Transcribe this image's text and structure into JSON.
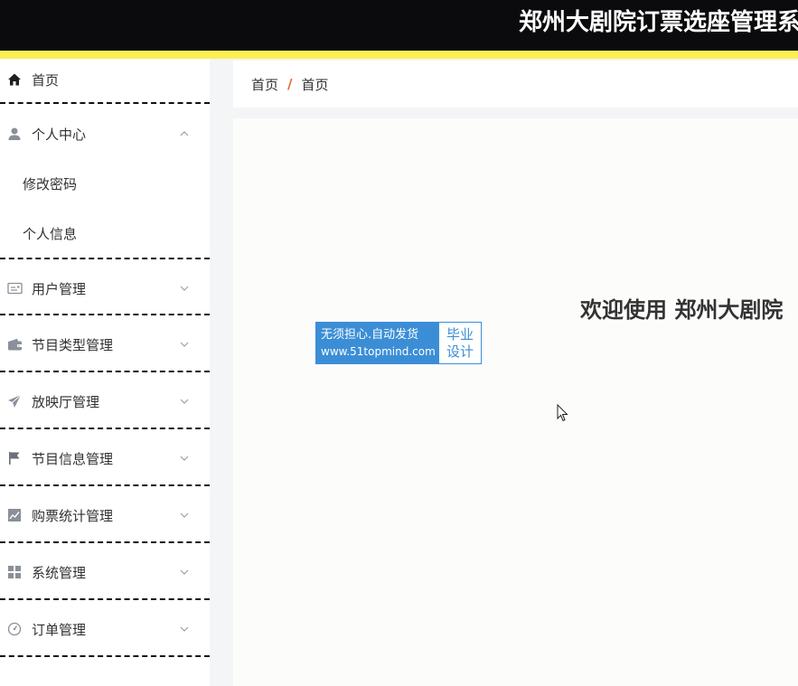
{
  "header": {
    "title": "郑州大剧院订票选座管理系",
    "background_color": "#0b0b0d",
    "stripe_color": "#fbef53"
  },
  "sidebar": {
    "items": [
      {
        "label": "首页",
        "icon": "home-icon"
      },
      {
        "label": "个人中心",
        "icon": "user-icon",
        "expanded": true,
        "children": [
          {
            "label": "修改密码"
          },
          {
            "label": "个人信息"
          }
        ]
      },
      {
        "label": "用户管理",
        "icon": "id-card-icon"
      },
      {
        "label": "节目类型管理",
        "icon": "wallet-icon"
      },
      {
        "label": "放映厅管理",
        "icon": "paper-plane-icon"
      },
      {
        "label": "节目信息管理",
        "icon": "flag-icon"
      },
      {
        "label": "购票统计管理",
        "icon": "line-chart-icon"
      },
      {
        "label": "系统管理",
        "icon": "grid-icon"
      },
      {
        "label": "订单管理",
        "icon": "gauge-icon"
      }
    ]
  },
  "breadcrumb": {
    "home": "首页",
    "separator": "/",
    "current": "首页",
    "separator_color": "#e3692b"
  },
  "main": {
    "welcome": "欢迎使用 郑州大剧院"
  },
  "watermark": {
    "line1": "无须担心.自动发货",
    "line2": "www.51topmind.com",
    "right_line1": "毕业",
    "right_line2": "设计",
    "color": "#3b8ed6"
  }
}
